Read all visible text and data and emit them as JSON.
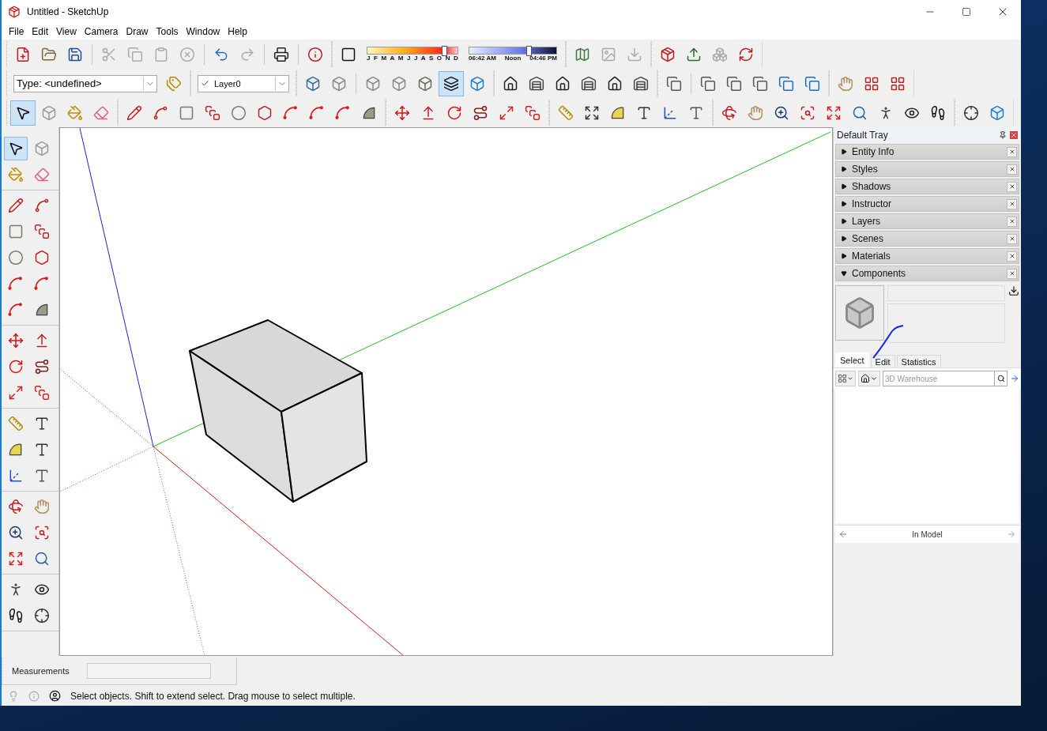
{
  "window": {
    "title": "Untitled - SketchUp"
  },
  "menu": [
    "File",
    "Edit",
    "View",
    "Camera",
    "Draw",
    "Tools",
    "Window",
    "Help"
  ],
  "date_slider": {
    "labels": "J F M A M J J A S O N D",
    "level": 0.85
  },
  "time_slider": {
    "start": "06:42 AM",
    "middle": "Noon",
    "end": "04:46 PM",
    "level": 0.68
  },
  "entity_type": {
    "value": "Type: <undefined>"
  },
  "layer": {
    "value": "Layer0"
  },
  "style_buttons": [
    {
      "selected": false
    },
    {
      "selected": false
    },
    {
      "selected": false
    },
    {
      "selected": false
    },
    {
      "selected": false
    },
    {
      "selected": true
    },
    {
      "selected": false
    }
  ],
  "principal_tools": [
    {
      "selected": true
    },
    {
      "selected": false
    },
    {
      "selected": false
    },
    {
      "selected": false
    }
  ],
  "large_tool_set": [
    {
      "selected": true
    },
    {
      "selected": false
    },
    {
      "selected": false
    },
    {
      "selected": false
    },
    {
      "selected": false
    },
    {
      "selected": false
    },
    {
      "selected": false
    },
    {
      "selected": false
    },
    {
      "selected": false
    },
    {
      "selected": false
    },
    {
      "selected": false
    },
    {
      "selected": false
    },
    {
      "selected": false
    },
    {
      "selected": false
    },
    {
      "selected": false
    },
    {
      "selected": false
    },
    {
      "selected": false
    },
    {
      "selected": false
    },
    {
      "selected": false
    },
    {
      "selected": false
    },
    {
      "selected": false
    },
    {
      "selected": false
    },
    {
      "selected": false
    },
    {
      "selected": false
    },
    {
      "selected": false
    },
    {
      "selected": false
    },
    {
      "selected": false
    },
    {
      "selected": false
    },
    {
      "selected": false
    },
    {
      "selected": false
    },
    {
      "selected": false
    },
    {
      "selected": false
    },
    {
      "selected": false
    },
    {
      "selected": false
    },
    {
      "selected": false
    },
    {
      "selected": false
    }
  ],
  "tray": {
    "title": "Default Tray",
    "panels": [
      {
        "label": "Entity Info",
        "expanded": false
      },
      {
        "label": "Styles",
        "expanded": false
      },
      {
        "label": "Shadows",
        "expanded": false
      },
      {
        "label": "Instructor",
        "expanded": false
      },
      {
        "label": "Layers",
        "expanded": false
      },
      {
        "label": "Scenes",
        "expanded": false
      },
      {
        "label": "Materials",
        "expanded": false
      },
      {
        "label": "Components",
        "expanded": true
      }
    ],
    "components": {
      "tabs": [
        {
          "label": "Select",
          "selected": true
        },
        {
          "label": "Edit",
          "selected": false
        },
        {
          "label": "Statistics",
          "selected": false
        }
      ],
      "search": {
        "placeholder": "3D Warehouse"
      },
      "location": "In Model"
    }
  },
  "measurements": {
    "label": "Measurements"
  },
  "status_bar": {
    "message": "Select objects. Shift to extend select. Drag mouse to select multiple."
  }
}
